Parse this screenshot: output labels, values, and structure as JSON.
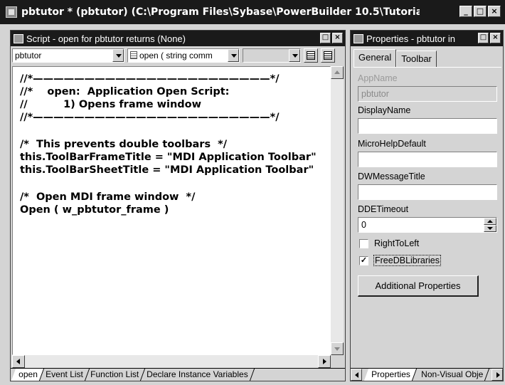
{
  "main_window": {
    "title": "pbtutor * (pbtutor) (C:\\Program Files\\Sybase\\PowerBuilder 10.5\\Tutorial\\pbtutor...",
    "buttons": {
      "minimize": "_",
      "maximize": "□",
      "close": "×"
    }
  },
  "script_window": {
    "title": "Script - open for pbtutor returns (None)",
    "buttons": {
      "maximize": "□",
      "close": "×"
    },
    "object_combo": "pbtutor",
    "event_combo": "open ( string comm",
    "ancestor_combo": "",
    "code_lines": [
      "//*———————————————————————*/",
      "//*    open:  Application Open Script:",
      "//          1) Opens frame window",
      "//*———————————————————————*/",
      "",
      "/*  This prevents double toolbars  */",
      "this.ToolBarFrameTitle = \"MDI Application Toolbar\"",
      "this.ToolBarSheetTitle = \"MDI Application Toolbar\"",
      "",
      "/*  Open MDI frame window  */",
      "Open ( w_pbtutor_frame )"
    ],
    "bottom_tabs": [
      "open",
      "Event List",
      "Function List",
      "Declare Instance Variables"
    ]
  },
  "properties_window": {
    "title": "Properties - pbtutor  in",
    "buttons": {
      "maximize": "□",
      "close": "×"
    },
    "tabs": [
      "General",
      "Toolbar"
    ],
    "fields": {
      "appname_label": "AppName",
      "appname_value": "pbtutor",
      "displayname_label": "DisplayName",
      "displayname_value": "",
      "microhelp_label": "MicroHelpDefault",
      "microhelp_value": "",
      "dwmessage_label": "DWMessageTitle",
      "dwmessage_value": "",
      "ddetimeout_label": "DDETimeout",
      "ddetimeout_value": "0"
    },
    "checkboxes": {
      "righttoleft_label": "RightToLeft",
      "righttoleft_checked": false,
      "freedb_label": "FreeDBLibraries",
      "freedb_checked": true,
      "check_mark": "✓"
    },
    "additional_button": "Additional Properties",
    "bottom_tabs": [
      "Properties",
      "Non-Visual Obje"
    ]
  }
}
